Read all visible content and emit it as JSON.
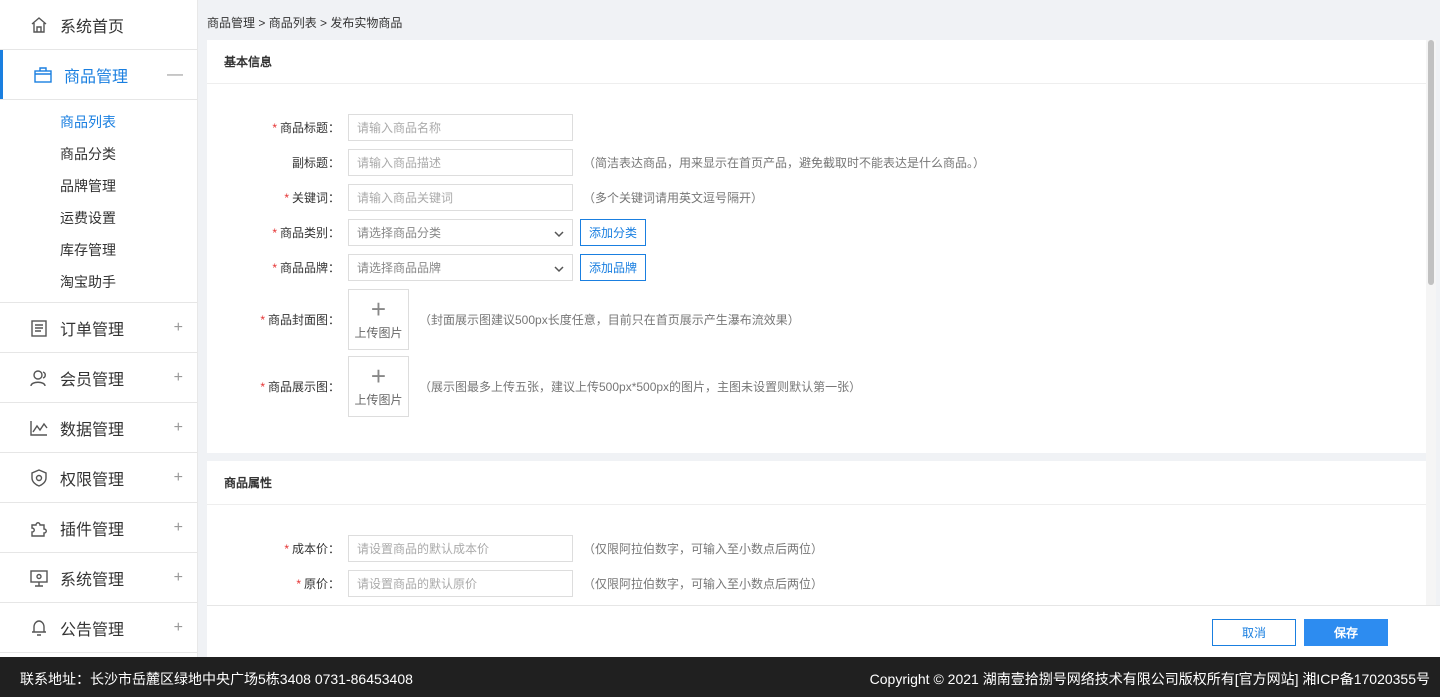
{
  "sidebar": {
    "home": {
      "label": "系统首页",
      "icon": "home-icon"
    },
    "goods": {
      "label": "商品管理",
      "icon": "bag-icon",
      "toggle": "—"
    },
    "sub_items": [
      "商品列表",
      "商品分类",
      "品牌管理",
      "运费设置",
      "库存管理",
      "淘宝助手"
    ],
    "menus": [
      {
        "label": "订单管理",
        "icon": "order-icon",
        "toggle": "+"
      },
      {
        "label": "会员管理",
        "icon": "member-icon",
        "toggle": "+"
      },
      {
        "label": "数据管理",
        "icon": "chart-icon",
        "toggle": "+"
      },
      {
        "label": "权限管理",
        "icon": "shield-icon",
        "toggle": "+"
      },
      {
        "label": "插件管理",
        "icon": "puzzle-icon",
        "toggle": "+"
      },
      {
        "label": "系统管理",
        "icon": "monitor-icon",
        "toggle": "+"
      },
      {
        "label": "公告管理",
        "icon": "bell-icon",
        "toggle": "+"
      }
    ]
  },
  "breadcrumb": {
    "part1": "商品管理",
    "sep": " > ",
    "part2": "商品列表",
    "part3": "发布实物商品"
  },
  "basic": {
    "title": "基本信息",
    "fields": {
      "name": {
        "label": "商品标题：",
        "required": "*",
        "placeholder": "请输入商品名称"
      },
      "subtitle": {
        "label": "副标题：",
        "placeholder": "请输入商品描述",
        "hint": "（简洁表达商品，用来显示在首页产品，避免截取时不能表达是什么商品。）"
      },
      "keywords": {
        "label": "关键词：",
        "required": "*",
        "placeholder": "请输入商品关键词",
        "hint": "（多个关键词请用英文逗号隔开）"
      },
      "category": {
        "label": "商品类别：",
        "required": "*",
        "selected": "请选择商品分类",
        "button": "添加分类"
      },
      "brand": {
        "label": "商品品牌：",
        "required": "*",
        "selected": "请选择商品品牌",
        "button": "添加品牌"
      },
      "cover": {
        "label": "商品封面图：",
        "required": "*",
        "upload": "上传图片",
        "hint": "（封面展示图建议500px长度任意，目前只在首页展示产生瀑布流效果）"
      },
      "gallery": {
        "label": "商品展示图：",
        "required": "*",
        "upload": "上传图片",
        "hint": "（展示图最多上传五张，建议上传500px*500px的图片，主图未设置则默认第一张）"
      }
    }
  },
  "attrs": {
    "title": "商品属性",
    "fields": {
      "cost": {
        "label": "成本价：",
        "required": "*",
        "placeholder": "请设置商品的默认成本价",
        "hint": "（仅限阿拉伯数字，可输入至小数点后两位）"
      },
      "price": {
        "label": "原价：",
        "required": "*",
        "placeholder": "请设置商品的默认原价",
        "hint": "（仅限阿拉伯数字，可输入至小数点后两位）"
      }
    }
  },
  "actions": {
    "cancel": "取消",
    "save": "保存"
  },
  "footer": {
    "address": "联系地址：长沙市岳麓区绿地中央广场5栋3408 0731-86453408",
    "copyright": "Copyright © 2021 湖南壹拾捌号网络技术有限公司版权所有[官方网站]   湘ICP备17020355号"
  },
  "colors": {
    "accent": "#1a7fe0",
    "required": "#e53333",
    "footer_bg": "#202020",
    "save_bg": "#2d8cf0"
  }
}
